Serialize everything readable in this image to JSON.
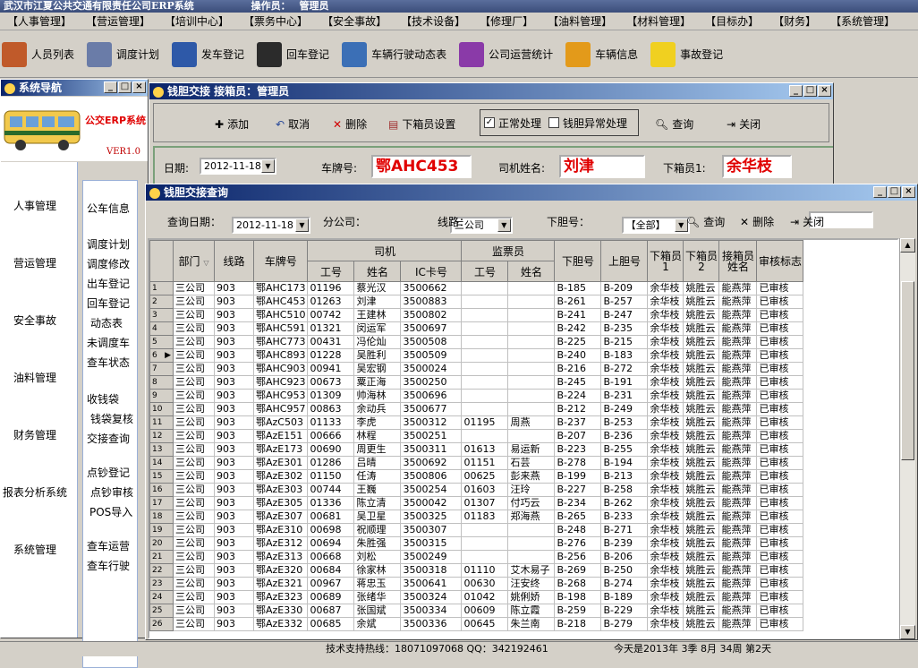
{
  "app": {
    "title": "武汉市江夏公共交通有限责任公司ERP系统",
    "operator_label": "操作员：",
    "operator": "管理员"
  },
  "menus": [
    "【人事管理】",
    "【营运管理】",
    "【培训中心】",
    "【票务中心】",
    "【安全事故】",
    "【技术设备】",
    "【修理厂】",
    "【油料管理】",
    "【材料管理】",
    "【目标办】",
    "【财务】",
    "【系统管理】"
  ],
  "toolbar": [
    {
      "label": "人员列表",
      "icon": "people-icon",
      "color": "#c05a2a"
    },
    {
      "label": "调度计划",
      "icon": "pen-icon",
      "color": "#6a7ca8"
    },
    {
      "label": "发车登记",
      "icon": "car-icon",
      "color": "#2e59a8"
    },
    {
      "label": "回车登记",
      "icon": "taxi-icon",
      "color": "#2b2b2b"
    },
    {
      "label": "车辆行驶动态表",
      "icon": "bus-icon",
      "color": "#3b6fb6"
    },
    {
      "label": "公司运营统计",
      "icon": "chart-icon",
      "color": "#8a3aa8"
    },
    {
      "label": "车辆信息",
      "icon": "truck-icon",
      "color": "#e39a1a"
    },
    {
      "label": "事故登记",
      "icon": "bulb-icon",
      "color": "#f0d020"
    }
  ],
  "nav": {
    "title": "系统导航",
    "brand": "公交ERP系统",
    "version": "VER1.0",
    "items": [
      "人事管理",
      "营运管理",
      "安全事故",
      "油料管理",
      "财务管理",
      "报表分析系统",
      "系统管理"
    ],
    "subitems": [
      "公车信息",
      "调度计划",
      "调度修改",
      "出车登记",
      "回车登记",
      "动态表",
      "未调度车",
      "查车状态",
      "收钱袋",
      "钱袋复核",
      "交接查询",
      "点钞登记",
      "点钞审核",
      "POS导入",
      "查车运营",
      "查车行驶"
    ]
  },
  "handover": {
    "title": "钱胆交接  接箱员：管理员",
    "buttons": {
      "add": "添加",
      "cancel": "取消",
      "delete": "删除",
      "setup": "下箱员设置",
      "query": "查询",
      "close": "关闭"
    },
    "normal_label": "正常处理",
    "normal_checked": true,
    "abnormal_label": "钱胆异常处理",
    "abnormal_checked": false,
    "date_label": "日期:",
    "date_value": "2012-11-18",
    "plate_label": "车牌号:",
    "plate_value": "鄂AHC453",
    "driver_label": "司机姓名:",
    "driver_value": "刘津",
    "unloader_label": "下箱员1:",
    "unloader_value": "余华枝"
  },
  "query": {
    "title": "钱胆交接查询",
    "date_label": "查询日期：",
    "date_value": "2012-11-18",
    "company_label": "分公司：",
    "company_value": "三公司",
    "route_label": "线路：",
    "route_value": "【全部】",
    "bag_label": "下胆号：",
    "bag_value": "",
    "query_btn": "查询",
    "delete_btn": "删除",
    "close_btn": "关闭"
  },
  "table": {
    "group_driver": "司机",
    "group_inspector": "监票员",
    "headers": {
      "dept": "部门",
      "route": "线路",
      "plate": "车牌号",
      "d_id": "工号",
      "d_name": "姓名",
      "d_ic": "IC卡号",
      "i_id": "工号",
      "i_name": "姓名",
      "down": "下胆号",
      "up": "上胆号",
      "dx1": "下箱员1",
      "dx2": "下箱员2",
      "recv": "接箱员姓名",
      "audit": "审核标志"
    },
    "current_row": 6,
    "rows": [
      [
        "1",
        "三公司",
        "903",
        "鄂AHC173",
        "01196",
        "蔡光汉",
        "3500662",
        "",
        "",
        "B-185",
        "B-209",
        "余华枝",
        "姚胜云",
        "能燕萍",
        "已审核"
      ],
      [
        "2",
        "三公司",
        "903",
        "鄂AHC453",
        "01263",
        "刘津",
        "3500883",
        "",
        "",
        "B-261",
        "B-257",
        "余华枝",
        "姚胜云",
        "能燕萍",
        "已审核"
      ],
      [
        "3",
        "三公司",
        "903",
        "鄂AHC510",
        "00742",
        "王建林",
        "3500802",
        "",
        "",
        "B-241",
        "B-247",
        "余华枝",
        "姚胜云",
        "能燕萍",
        "已审核"
      ],
      [
        "4",
        "三公司",
        "903",
        "鄂AHC591",
        "01321",
        "闵运军",
        "3500697",
        "",
        "",
        "B-242",
        "B-235",
        "余华枝",
        "姚胜云",
        "能燕萍",
        "已审核"
      ],
      [
        "5",
        "三公司",
        "903",
        "鄂AHC773",
        "00431",
        "冯伦灿",
        "3500508",
        "",
        "",
        "B-225",
        "B-215",
        "余华枝",
        "姚胜云",
        "能燕萍",
        "已审核"
      ],
      [
        "6",
        "三公司",
        "903",
        "鄂AHC893",
        "01228",
        "吴胜利",
        "3500509",
        "",
        "",
        "B-240",
        "B-183",
        "余华枝",
        "姚胜云",
        "能燕萍",
        "已审核"
      ],
      [
        "7",
        "三公司",
        "903",
        "鄂AHC903",
        "00941",
        "吴宏钢",
        "3500024",
        "",
        "",
        "B-216",
        "B-272",
        "余华枝",
        "姚胜云",
        "能燕萍",
        "已审核"
      ],
      [
        "8",
        "三公司",
        "903",
        "鄂AHC923",
        "00673",
        "粟正海",
        "3500250",
        "",
        "",
        "B-245",
        "B-191",
        "余华枝",
        "姚胜云",
        "能燕萍",
        "已审核"
      ],
      [
        "9",
        "三公司",
        "903",
        "鄂AHC953",
        "01309",
        "帅海林",
        "3500696",
        "",
        "",
        "B-224",
        "B-231",
        "余华枝",
        "姚胜云",
        "能燕萍",
        "已审核"
      ],
      [
        "10",
        "三公司",
        "903",
        "鄂AHC957",
        "00863",
        "余动兵",
        "3500677",
        "",
        "",
        "B-212",
        "B-249",
        "余华枝",
        "姚胜云",
        "能燕萍",
        "已审核"
      ],
      [
        "11",
        "三公司",
        "903",
        "鄂AzC503",
        "01133",
        "李虎",
        "3500312",
        "01195",
        "周燕",
        "B-237",
        "B-253",
        "余华枝",
        "姚胜云",
        "能燕萍",
        "已审核"
      ],
      [
        "12",
        "三公司",
        "903",
        "鄂AzE151",
        "00666",
        "林程",
        "3500251",
        "",
        "",
        "B-207",
        "B-236",
        "余华枝",
        "姚胜云",
        "能燕萍",
        "已审核"
      ],
      [
        "13",
        "三公司",
        "903",
        "鄂AzE173",
        "00690",
        "周更生",
        "3500311",
        "01613",
        "易运新",
        "B-223",
        "B-255",
        "余华枝",
        "姚胜云",
        "能燕萍",
        "已审核"
      ],
      [
        "14",
        "三公司",
        "903",
        "鄂AzE301",
        "01286",
        "吕晴",
        "3500692",
        "01151",
        "石芸",
        "B-278",
        "B-194",
        "余华枝",
        "姚胜云",
        "能燕萍",
        "已审核"
      ],
      [
        "15",
        "三公司",
        "903",
        "鄂AzE302",
        "01150",
        "任涛",
        "3500806",
        "00625",
        "彭来燕",
        "B-199",
        "B-213",
        "余华枝",
        "姚胜云",
        "能燕萍",
        "已审核"
      ],
      [
        "16",
        "三公司",
        "903",
        "鄂AzE303",
        "00744",
        "王巍",
        "3500254",
        "01603",
        "汪玲",
        "B-227",
        "B-258",
        "余华枝",
        "姚胜云",
        "能燕萍",
        "已审核"
      ],
      [
        "17",
        "三公司",
        "903",
        "鄂AzE305",
        "01336",
        "陈立清",
        "3500042",
        "01307",
        "付巧云",
        "B-234",
        "B-262",
        "余华枝",
        "姚胜云",
        "能燕萍",
        "已审核"
      ],
      [
        "18",
        "三公司",
        "903",
        "鄂AzE307",
        "00681",
        "吴卫星",
        "3500325",
        "01183",
        "郑海燕",
        "B-265",
        "B-233",
        "余华枝",
        "姚胜云",
        "能燕萍",
        "已审核"
      ],
      [
        "19",
        "三公司",
        "903",
        "鄂AzE310",
        "00698",
        "祝顺理",
        "3500307",
        "",
        "",
        "B-248",
        "B-271",
        "余华枝",
        "姚胜云",
        "能燕萍",
        "已审核"
      ],
      [
        "20",
        "三公司",
        "903",
        "鄂AzE312",
        "00694",
        "朱胜强",
        "3500315",
        "",
        "",
        "B-276",
        "B-239",
        "余华枝",
        "姚胜云",
        "能燕萍",
        "已审核"
      ],
      [
        "21",
        "三公司",
        "903",
        "鄂AzE313",
        "00668",
        "刘松",
        "3500249",
        "",
        "",
        "B-256",
        "B-206",
        "余华枝",
        "姚胜云",
        "能燕萍",
        "已审核"
      ],
      [
        "22",
        "三公司",
        "903",
        "鄂AzE320",
        "00684",
        "徐家林",
        "3500318",
        "01110",
        "艾木易子",
        "B-269",
        "B-250",
        "余华枝",
        "姚胜云",
        "能燕萍",
        "已审核"
      ],
      [
        "23",
        "三公司",
        "903",
        "鄂AzE321",
        "00967",
        "蒋忠玉",
        "3500641",
        "00630",
        "汪安终",
        "B-268",
        "B-274",
        "余华枝",
        "姚胜云",
        "能燕萍",
        "已审核"
      ],
      [
        "24",
        "三公司",
        "903",
        "鄂AzE323",
        "00689",
        "张绪华",
        "3500324",
        "01042",
        "姚俐娇",
        "B-198",
        "B-189",
        "余华枝",
        "姚胜云",
        "能燕萍",
        "已审核"
      ],
      [
        "25",
        "三公司",
        "903",
        "鄂AzE330",
        "00687",
        "张国斌",
        "3500334",
        "00609",
        "陈立霞",
        "B-259",
        "B-229",
        "余华枝",
        "姚胜云",
        "能燕萍",
        "已审核"
      ],
      [
        "26",
        "三公司",
        "903",
        "鄂AzE332",
        "00685",
        "余斌",
        "3500336",
        "00645",
        "朱兰南",
        "B-218",
        "B-279",
        "余华枝",
        "姚胜云",
        "能燕萍",
        "已审核"
      ]
    ]
  },
  "status": {
    "hotline": "技术支持热线：18071097068  QQ：342192461",
    "today": "今天是2013年 3季 8月 34周 第2天"
  }
}
